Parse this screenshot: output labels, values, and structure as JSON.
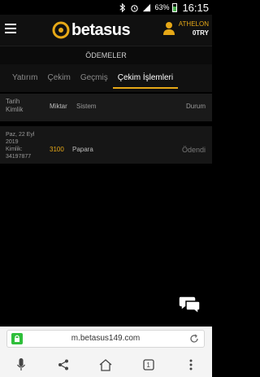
{
  "status_bar": {
    "battery_percent": "63%",
    "battery_level": 0.63,
    "time": "16:15",
    "icons": [
      "bluetooth-icon",
      "alarm-icon",
      "signal-icon",
      "battery-icon"
    ]
  },
  "header": {
    "logo_text": "betasus",
    "user": {
      "name": "ATHELON",
      "balance": "0TRY"
    }
  },
  "page_title": "ÖDEMELER",
  "tabs": [
    {
      "label": "Yatırım",
      "active": false
    },
    {
      "label": "Çekim",
      "active": false
    },
    {
      "label": "Geçmiş",
      "active": false
    },
    {
      "label": "Çekim İşlemleri",
      "active": true
    }
  ],
  "table": {
    "headers": {
      "date_line1": "Tarih",
      "date_line2": "Kimlik",
      "amount": "Miktar",
      "system": "Sistem",
      "status": "Durum"
    },
    "rows": [
      {
        "date_line1": "Paz, 22 Eyl",
        "date_line2": "2019",
        "id_label": "Kimlik:",
        "id_value": "34197877",
        "amount": "3100",
        "system": "Papara",
        "status": "Ödendi"
      }
    ]
  },
  "browser": {
    "url": "m.betasus149.com",
    "tab_count": "1"
  },
  "colors": {
    "accent": "#e6a817",
    "background": "#000000",
    "lock_green": "#2fbf3b"
  }
}
